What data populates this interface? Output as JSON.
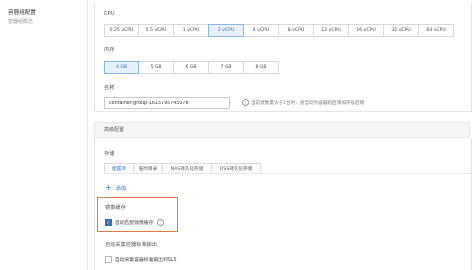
{
  "sidebar": {
    "title": "容器组配置",
    "subtitle": "容器组概念"
  },
  "cpu": {
    "label": "CPU",
    "options": [
      "0.25 vCPU",
      "0.5 vCPU",
      "1 vCPU",
      "2 vCPU",
      "4 vCPU",
      "8 vCPU",
      "12 vCPU",
      "16 vCPU",
      "32 vCPU",
      "64 vCPU"
    ],
    "selected": "2 vCPU"
  },
  "memory": {
    "label": "内存",
    "options": [
      "4 GB",
      "5 GB",
      "6 GB",
      "7 GB",
      "8 GB"
    ],
    "selected": "4 GB"
  },
  "name": {
    "label": "名称",
    "value": "container-group-1615795745078",
    "hint": "当前建数量大于1台时，会自动为容器组后添加序号后缀"
  },
  "advanced": {
    "title": "高级配置"
  },
  "storage": {
    "label": "存储",
    "tabs": [
      "配置项",
      "临时目录",
      "NAS持久化存储",
      "OSS持久化存储"
    ],
    "active_tab": "配置项",
    "add_label": "添加"
  },
  "image_cache": {
    "label": "镜像缓存",
    "auto_match_label": "自动匹配镜像缓存",
    "auto_match_checked": true
  },
  "log": {
    "label": "自动采集容器标准输出",
    "checkbox_label": "自动采集容器标准输出到SLS",
    "checked": false
  },
  "colors": {
    "accent": "#2f6fb3",
    "highlight_border": "#e07a3f"
  },
  "icons": {
    "info": "info-icon",
    "add": "plus-icon",
    "check": "check-icon"
  }
}
